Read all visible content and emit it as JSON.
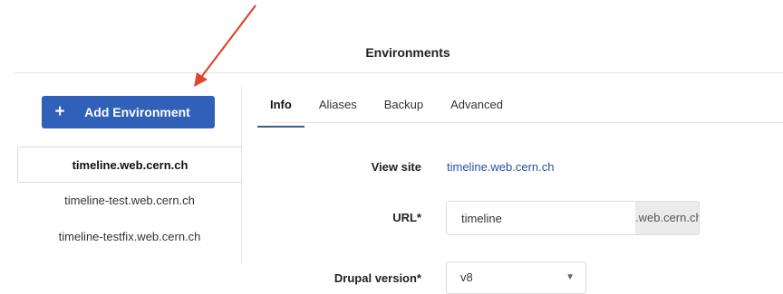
{
  "header": {
    "title": "Environments"
  },
  "sidebar": {
    "add_button": {
      "icon": "plus-icon",
      "label": "Add Environment"
    },
    "environments": [
      {
        "name": "timeline.web.cern.ch",
        "active": true
      },
      {
        "name": "timeline-test.web.cern.ch",
        "active": false
      },
      {
        "name": "timeline-testfix.web.cern.ch",
        "active": false
      }
    ]
  },
  "tabs": [
    {
      "label": "Info",
      "active": true
    },
    {
      "label": "Aliases",
      "active": false
    },
    {
      "label": "Backup",
      "active": false
    },
    {
      "label": "Advanced",
      "active": false
    }
  ],
  "info": {
    "view_site": {
      "label": "View site",
      "link": "timeline.web.cern.ch"
    },
    "url": {
      "label": "URL*",
      "value": "timeline",
      "suffix": ".web.cern.ch"
    },
    "drupal_version": {
      "label": "Drupal version*",
      "value": "v8"
    }
  },
  "annotation": {
    "color": "#e0452e",
    "icon": "arrow-pointer"
  },
  "colors": {
    "primary_button": "#3060b8",
    "link": "#2a4f9e",
    "tab_underline": "#3b5b8c"
  }
}
